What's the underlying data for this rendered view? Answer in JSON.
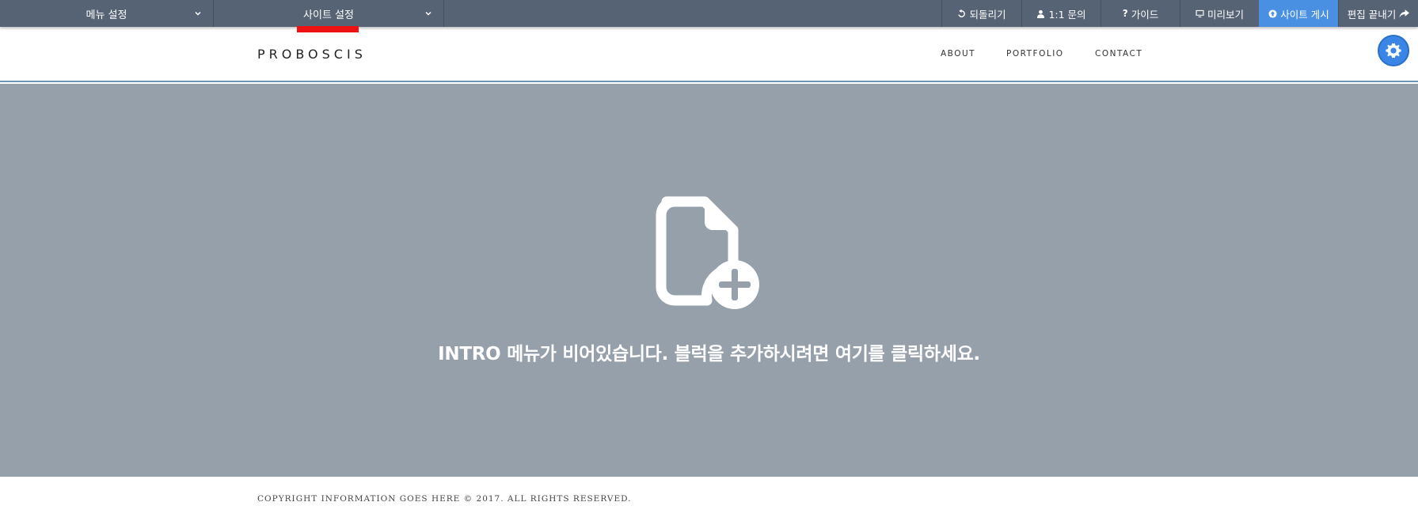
{
  "toolbar": {
    "menu_setting": "메뉴 설정",
    "site_setting": "사이트 설정",
    "undo": "되돌리기",
    "inquiry": "1:1 문의",
    "guide": "가이드",
    "preview": "미리보기",
    "publish": "사이트 게시",
    "finish_edit": "편집 끝내기",
    "active_color": "#ee1111",
    "publish_color": "#4a90e2"
  },
  "header": {
    "logo": "PROBOSCIS",
    "nav": [
      "ABOUT",
      "PORTFOLIO",
      "CONTACT"
    ],
    "settings_icon": "gear-icon"
  },
  "intro": {
    "icon": "add-document-icon",
    "message": "INTRO 메뉴가 비어있습니다. 블럭을 추가하시려면 여기를 클릭하세요."
  },
  "footer": {
    "copyright": "COPYRIGHT INFORMATION GOES HERE © 2017. ALL RIGHTS RESERVED."
  }
}
